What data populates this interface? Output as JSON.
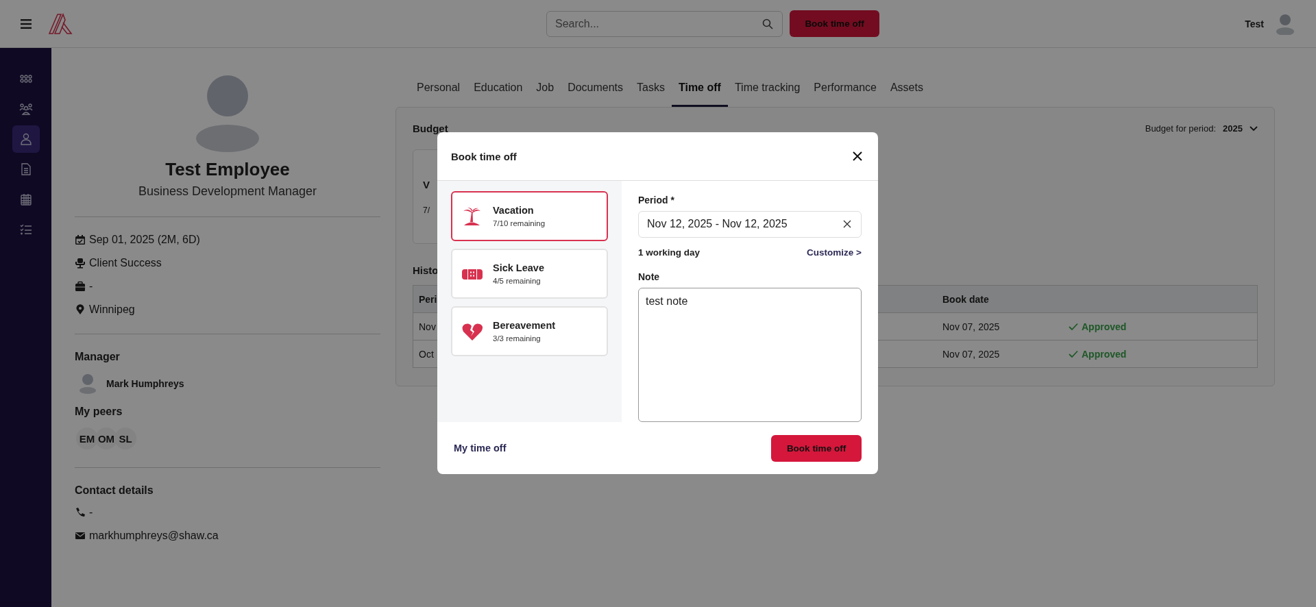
{
  "top_bar": {
    "search": {
      "placeholder": "Search..."
    },
    "book_button": "Book time off",
    "user_name": "Test"
  },
  "sidebar": {
    "items": [
      {
        "selected": false
      },
      {
        "selected": false
      },
      {
        "selected": true
      },
      {
        "selected": false
      },
      {
        "selected": false
      },
      {
        "selected": false
      }
    ]
  },
  "profile": {
    "name": "Test Employee",
    "job_title": "Business Development Manager",
    "details": [
      {
        "text": "Sep 01, 2025 (2M, 6D)"
      },
      {
        "text": "Client Success"
      },
      {
        "text": "-"
      },
      {
        "text": "Winnipeg"
      }
    ],
    "manager_heading": "Manager",
    "manager": {
      "name": "Mark Humphreys"
    },
    "peers_heading": "My peers",
    "peers": [
      "EM",
      "OM",
      "SL"
    ],
    "contact_heading": "Contact details",
    "contact": [
      {
        "text": "-"
      },
      {
        "text": "markhumphreys@shaw.ca"
      }
    ]
  },
  "tabs": [
    {
      "label": "Personal",
      "selected": false
    },
    {
      "label": "Education",
      "selected": false
    },
    {
      "label": "Job",
      "selected": false
    },
    {
      "label": "Documents",
      "selected": false
    },
    {
      "label": "Tasks",
      "selected": false
    },
    {
      "label": "Time off",
      "selected": true
    },
    {
      "label": "Time tracking",
      "selected": false
    },
    {
      "label": "Performance",
      "selected": false
    },
    {
      "label": "Assets",
      "selected": false
    }
  ],
  "budget": {
    "title": "Budget",
    "period_label": "Budget for period:",
    "period_value": "2025",
    "card": {
      "name": "V",
      "remaining": "7/"
    }
  },
  "history": {
    "title": "Histo",
    "columns": [
      "Peri",
      "Book date"
    ],
    "rows": [
      {
        "period": "Nov",
        "book_date": "Nov 07, 2025",
        "status": "Approved"
      },
      {
        "period": "Oct",
        "book_date": "Nov 07, 2025",
        "status": "Approved"
      }
    ]
  },
  "modal": {
    "title": "Book time off",
    "types": [
      {
        "name": "Vacation",
        "remaining": "7/10 remaining",
        "selected": true
      },
      {
        "name": "Sick Leave",
        "remaining": "4/5 remaining",
        "selected": false
      },
      {
        "name": "Bereavement",
        "remaining": "3/3 remaining",
        "selected": false
      }
    ],
    "period_label": "Period *",
    "period_value": "Nov 12, 2025 - Nov 12, 2025",
    "working_days": "1 working day",
    "customize": "Customize >",
    "note_label": "Note",
    "note_value": "test note",
    "my_time_off": "My time off",
    "submit": "Book time off"
  }
}
